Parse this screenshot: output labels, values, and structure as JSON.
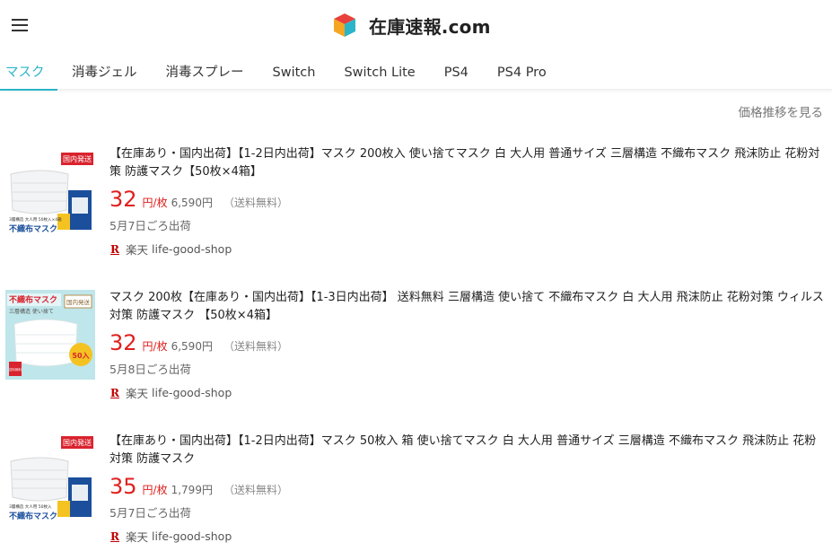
{
  "header": {
    "site_title": "在庫速報.com",
    "menu_icon": "hamburger-menu-icon",
    "logo_icon": "colored-cube-icon"
  },
  "tabs": [
    {
      "label": "マスク",
      "active": true
    },
    {
      "label": "消毒ジェル"
    },
    {
      "label": "消毒スプレー"
    },
    {
      "label": "Switch"
    },
    {
      "label": "Switch Lite"
    },
    {
      "label": "PS4"
    },
    {
      "label": "PS4 Pro"
    }
  ],
  "price_history_link": "価格推移を見る",
  "items": [
    {
      "title": "【在庫あり・国内出荷】【1-2日内出荷】マスク 200枚入 使い捨てマスク 白 大人用 普通サイズ 三層構造 不織布マスク 飛沫防止 花粉対策 防護マスク【50枚×4箱】",
      "unit_price": "32",
      "unit_label": "円/枚",
      "total_price": "6,590円",
      "shipping": "（送料無料）",
      "ship_date": "5月7日ごろ出荷",
      "market": "楽天",
      "shop": "life-good-shop",
      "thumb_badge": "国内発送",
      "thumb_caption": "不織布マスク",
      "thumb_sub": "3層構造 大人用 50枚入×4箱"
    },
    {
      "title": "マスク 200枚【在庫あり・国内出荷】【1-3日内出荷】 送料無料 三層構造 使い捨て 不織布マスク 白 大人用 飛沫防止 花粉対策 ウィルス対策 防護マスク 【50枚×4箱】",
      "unit_price": "32",
      "unit_label": "円/枚",
      "total_price": "6,590円",
      "shipping": "（送料無料）",
      "ship_date": "5月8日ごろ出荷",
      "market": "楽天",
      "shop": "life-good-shop",
      "thumb_badge": "国内発送",
      "thumb_caption": "不織布マスク",
      "thumb_sub": "三層構造 使い捨て",
      "thumb_count": "50入",
      "thumb_free": "送料無料"
    },
    {
      "title": "【在庫あり・国内出荷】【1-2日内出荷】マスク 50枚入 箱 使い捨てマスク 白 大人用 普通サイズ 三層構造 不織布マスク 飛沫防止 花粉対策 防護マスク",
      "unit_price": "35",
      "unit_label": "円/枚",
      "total_price": "1,799円",
      "shipping": "（送料無料）",
      "ship_date": "5月7日ごろ出荷",
      "market": "楽天",
      "shop": "life-good-shop",
      "thumb_badge": "国内発送",
      "thumb_caption": "不織布マスク",
      "thumb_sub": "3層構造 大人用 50枚入"
    }
  ],
  "colors": {
    "accent": "#2cb5c8",
    "price": "#e0201e",
    "rakuten": "#bf0000"
  }
}
